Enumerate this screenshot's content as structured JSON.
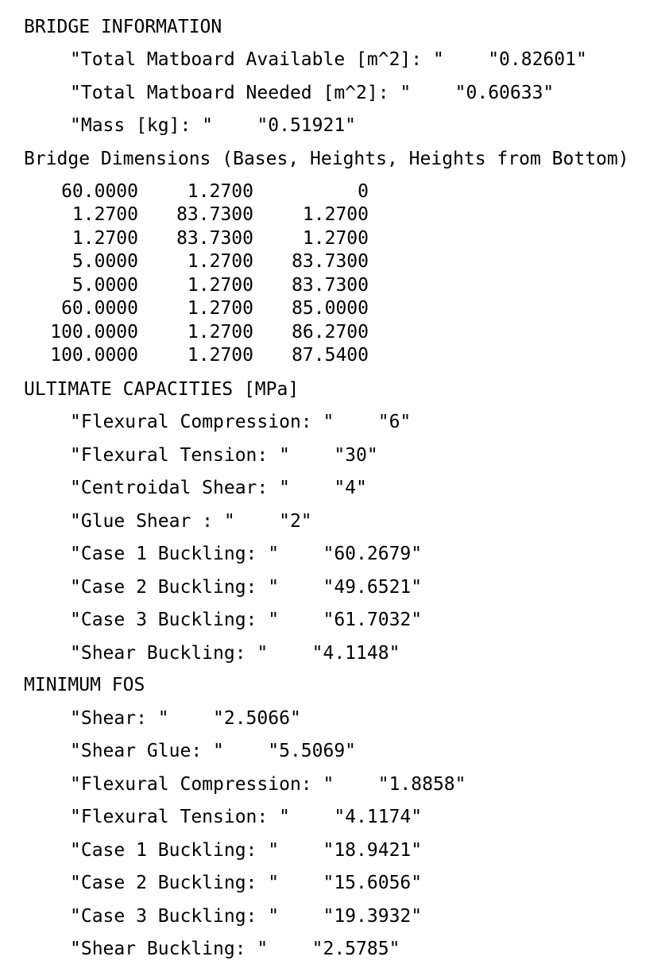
{
  "bridge_information": {
    "heading": "BRIDGE INFORMATION",
    "items": [
      "\"Total Matboard Available [m^2]: \"    \"0.82601\"",
      "\"Total Matboard Needed [m^2]: \"    \"0.60633\"",
      "\"Mass [kg]: \"    \"0.51921\""
    ]
  },
  "bridge_dimensions": {
    "heading": "Bridge Dimensions (Bases, Heights, Heights from Bottom)",
    "rows": [
      [
        "60.0000",
        "1.2700",
        "0"
      ],
      [
        "1.2700",
        "83.7300",
        "1.2700"
      ],
      [
        "1.2700",
        "83.7300",
        "1.2700"
      ],
      [
        "5.0000",
        "1.2700",
        "83.7300"
      ],
      [
        "5.0000",
        "1.2700",
        "83.7300"
      ],
      [
        "60.0000",
        "1.2700",
        "85.0000"
      ],
      [
        "100.0000",
        "1.2700",
        "86.2700"
      ],
      [
        "100.0000",
        "1.2700",
        "87.5400"
      ]
    ]
  },
  "ultimate_capacities": {
    "heading": "ULTIMATE CAPACITIES [MPa]",
    "items": [
      "\"Flexural Compression: \"    \"6\"",
      "\"Flexural Tension: \"    \"30\"",
      "\"Centroidal Shear: \"    \"4\"",
      "\"Glue Shear : \"    \"2\"",
      "\"Case 1 Buckling: \"    \"60.2679\"",
      "\"Case 2 Buckling: \"    \"49.6521\"",
      "\"Case 3 Buckling: \"    \"61.7032\"",
      "\"Shear Buckling: \"    \"4.1148\""
    ]
  },
  "minimum_fos": {
    "heading": "MINIMUM FOS",
    "items": [
      "\"Shear: \"    \"2.5066\"",
      "\"Shear Glue: \"    \"5.5069\"",
      "\"Flexural Compression: \"    \"1.8858\"",
      "\"Flexural Tension: \"    \"4.1174\"",
      "\"Case 1 Buckling: \"    \"18.9421\"",
      "\"Case 2 Buckling: \"    \"15.6056\"",
      "\"Case 3 Buckling: \"    \"19.3932\"",
      "\"Shear Buckling: \"    \"2.5785\""
    ]
  }
}
